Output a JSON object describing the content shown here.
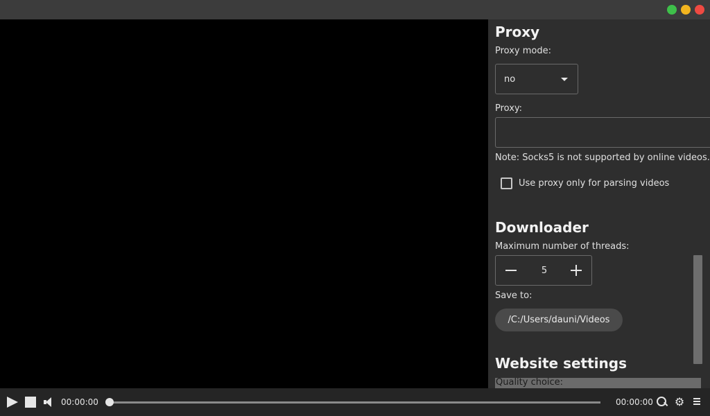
{
  "proxy": {
    "heading": "Proxy",
    "mode_label": "Proxy mode:",
    "mode_value": "no",
    "proxy_label": "Proxy:",
    "proxy_value": "",
    "note": "Note: Socks5 is not supported by online videos.",
    "parse_only_label": "Use proxy only for parsing videos",
    "parse_only_checked": false
  },
  "downloader": {
    "heading": "Downloader",
    "threads_label": "Maximum number of threads:",
    "threads_value": "5",
    "save_label": "Save to:",
    "save_path": "/C:/Users/dauni/Videos"
  },
  "website": {
    "heading": "Website settings",
    "quality_label": "Quality choice:"
  },
  "player": {
    "current_time": "00:00:00",
    "total_time": "00:00:00",
    "progress": 0
  },
  "icons": {
    "play": "play-icon",
    "stop": "stop-icon",
    "volume": "volume-icon",
    "search": "search-icon",
    "settings": "gear-icon",
    "menu": "menu-icon",
    "gear_glyph": "⚙"
  },
  "colors": {
    "window_close": "#ef4a42",
    "window_minimize": "#f2b51f",
    "window_maximize": "#3ec04a",
    "panel_background": "#2e2e2e",
    "video_background": "#000000"
  }
}
